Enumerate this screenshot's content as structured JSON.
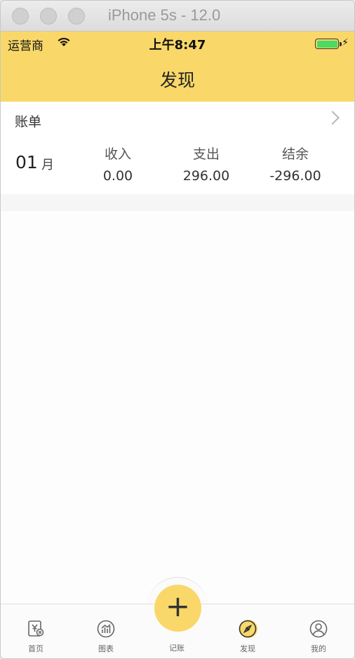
{
  "window": {
    "title": "iPhone 5s - 12.0"
  },
  "status_bar": {
    "carrier": "运营商",
    "time": "上午8:47",
    "wifi_icon": "wifi-icon",
    "battery_icon": "battery-icon"
  },
  "nav": {
    "title": "发现"
  },
  "bill": {
    "header": "账单",
    "month_number": "01",
    "month_unit": "月",
    "stats": [
      {
        "label": "收入",
        "value": "0.00"
      },
      {
        "label": "支出",
        "value": "296.00"
      },
      {
        "label": "结余",
        "value": "-296.00"
      }
    ]
  },
  "tabs": [
    {
      "label": "首页",
      "icon": "ledger-icon"
    },
    {
      "label": "图表",
      "icon": "chart-icon"
    },
    {
      "label": "记账",
      "icon": "plus-icon"
    },
    {
      "label": "发现",
      "icon": "compass-icon"
    },
    {
      "label": "我的",
      "icon": "profile-icon"
    }
  ],
  "add_button": {
    "symbol": "+"
  },
  "colors": {
    "accent": "#f9d869",
    "background": "#fdfdfd"
  }
}
